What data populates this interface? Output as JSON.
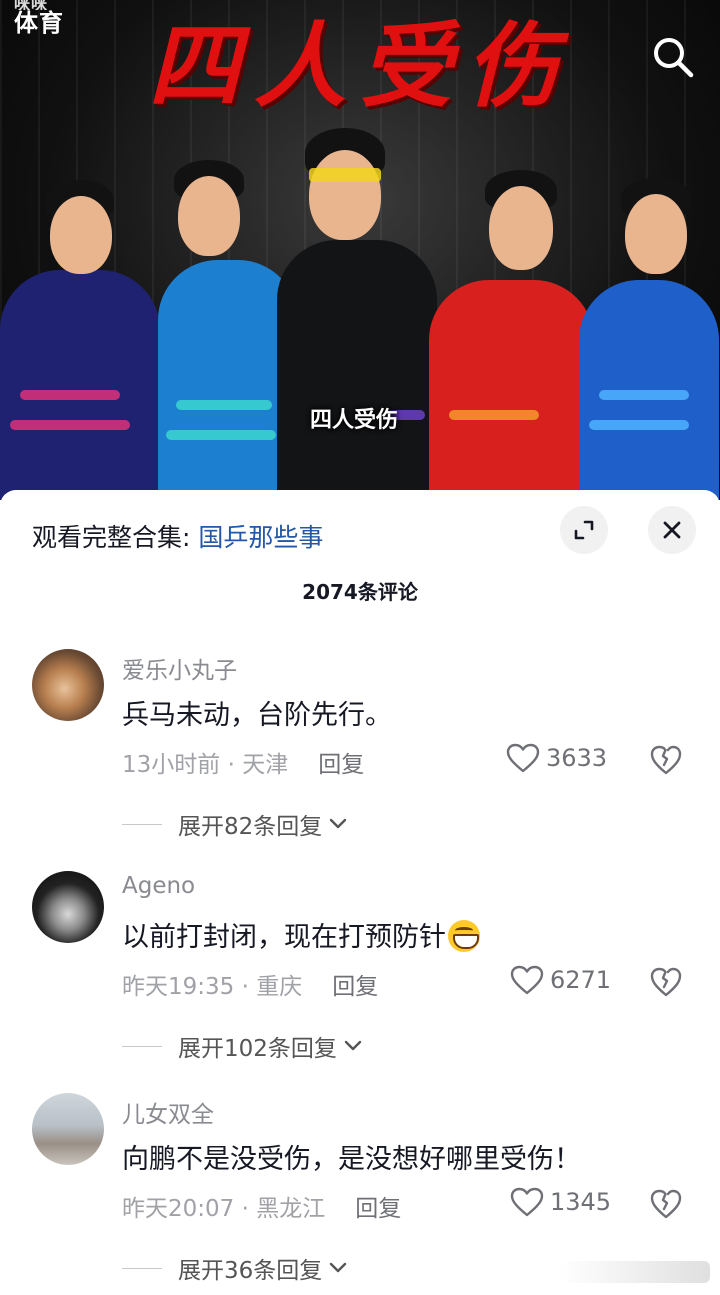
{
  "cover": {
    "brand_line1": "咪咪",
    "brand_line2": "体育",
    "headline": "四人受伤",
    "caption": "四人受伤"
  },
  "panel": {
    "collection_prefix": "观看完整合集:",
    "collection_name": "国乒那些事",
    "comment_count": "2074条评论"
  },
  "comments": [
    {
      "username": "爱乐小丸子",
      "text": "兵马未动，台阶先行。",
      "time": "13小时前 · 天津",
      "reply_label": "回复",
      "likes": "3633",
      "expand": "展开82条回复"
    },
    {
      "username": "Ageno",
      "text": "以前打封闭，现在打预防针",
      "emoji": "grinning-emoji",
      "time": "昨天19:35 · 重庆",
      "reply_label": "回复",
      "likes": "6271",
      "expand": "展开102条回复"
    },
    {
      "username": "儿女双全",
      "text": "向鹏不是没受伤，是没想好哪里受伤！",
      "time": "昨天20:07 · 黑龙江",
      "reply_label": "回复",
      "likes": "1345",
      "expand": "展开36条回复"
    }
  ],
  "icons": {
    "search": "search-icon",
    "expand": "fullscreen-icon",
    "close": "close-icon",
    "like": "heart-icon",
    "dislike": "broken-heart-icon",
    "chevron": "chevron-down-icon"
  },
  "colors": {
    "headline_red": "#e01010",
    "link_blue": "#2357a8",
    "muted_text": "#a1a2a7"
  }
}
